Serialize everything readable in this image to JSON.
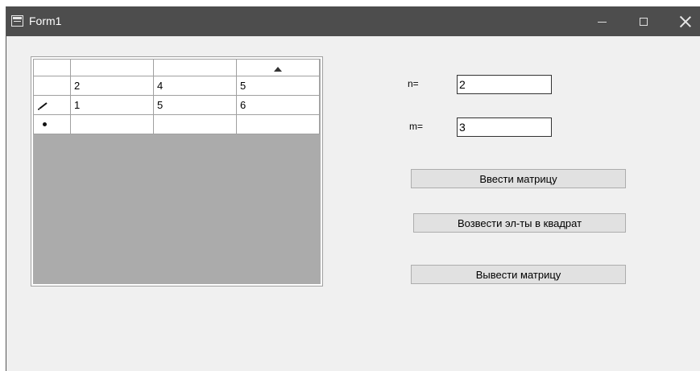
{
  "window": {
    "title": "Form1",
    "icons": {
      "app": "form-app-icon",
      "minimize": "minimize-icon",
      "maximize": "maximize-icon",
      "close": "close-icon"
    }
  },
  "grid": {
    "rows": [
      {
        "header_icon": "",
        "cells": [
          "2",
          "4",
          "5"
        ]
      },
      {
        "header_icon": "pencil-icon",
        "cells": [
          "1",
          "5",
          "6"
        ]
      },
      {
        "header_icon": "new-row-icon",
        "cells": [
          "",
          "",
          ""
        ]
      }
    ]
  },
  "form": {
    "n_label": "n=",
    "n_value": "2",
    "m_label": "m=",
    "m_value": "3",
    "btn_input": "Ввести матрицу",
    "btn_square": "Возвести эл-ты в квадрат",
    "btn_output": "Вывести матрицу"
  }
}
